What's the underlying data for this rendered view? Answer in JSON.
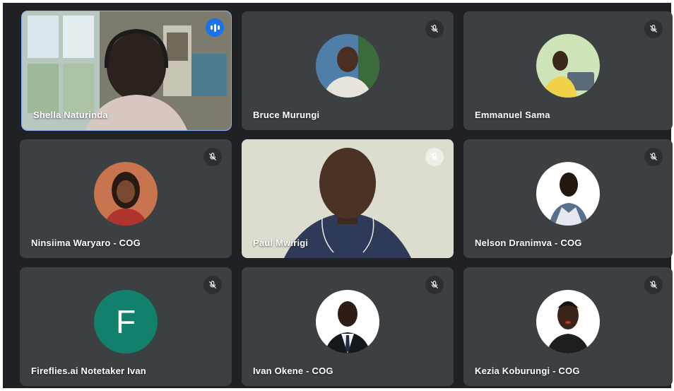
{
  "meeting": {
    "participants": [
      {
        "name": "Shella Naturinda",
        "state": "speaking",
        "video": true
      },
      {
        "name": "Bruce Murungi",
        "state": "muted",
        "video": false
      },
      {
        "name": "Emmanuel Sama",
        "state": "muted",
        "video": false
      },
      {
        "name": "Ninsiima Waryaro - COG",
        "state": "muted",
        "video": false
      },
      {
        "name": "Paul Mwirigi",
        "state": "muted",
        "video": true
      },
      {
        "name": "Nelson Dranimva - COG",
        "state": "muted",
        "video": false
      },
      {
        "name": "Fireflies.ai Notetaker Ivan",
        "state": "muted",
        "video": false,
        "avatar_letter": "F"
      },
      {
        "name": "Ivan Okene - COG",
        "state": "muted",
        "video": false
      },
      {
        "name": "Kezia Koburungi - COG",
        "state": "muted",
        "video": false
      }
    ]
  },
  "icons": {
    "muted": "mic-off-icon",
    "speaking": "audio-level-icon"
  },
  "colors": {
    "background": "#202124",
    "tile": "#3c4043",
    "active_border": "#8ab4f8",
    "speaking_badge": "#1a73e8",
    "letter_avatar": "#12806a"
  }
}
